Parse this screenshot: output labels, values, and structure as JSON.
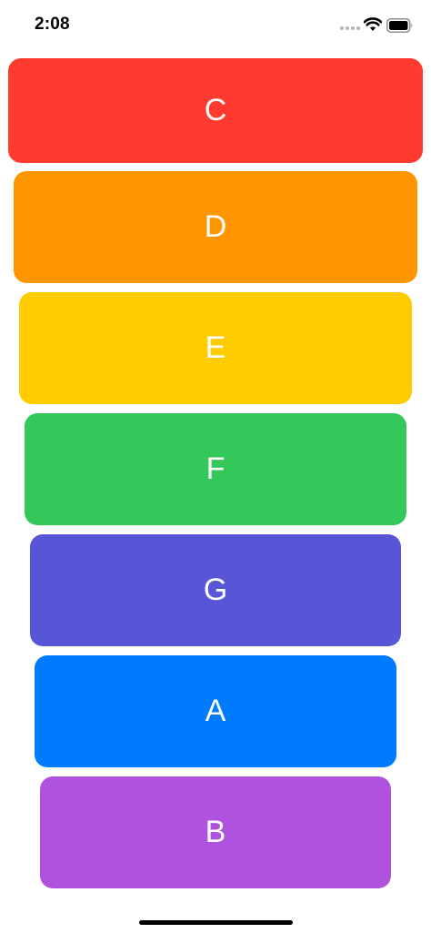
{
  "status_bar": {
    "time": "2:08",
    "signal_icon": "cellular-signal-icon",
    "wifi_icon": "wifi-icon",
    "battery_icon": "battery-icon"
  },
  "keys": [
    {
      "label": "C",
      "color": "#FF3B30"
    },
    {
      "label": "D",
      "color": "#FF9500"
    },
    {
      "label": "E",
      "color": "#FFCC00"
    },
    {
      "label": "F",
      "color": "#34C759"
    },
    {
      "label": "G",
      "color": "#5856D6"
    },
    {
      "label": "A",
      "color": "#007AFF"
    },
    {
      "label": "B",
      "color": "#AF52DE"
    }
  ]
}
